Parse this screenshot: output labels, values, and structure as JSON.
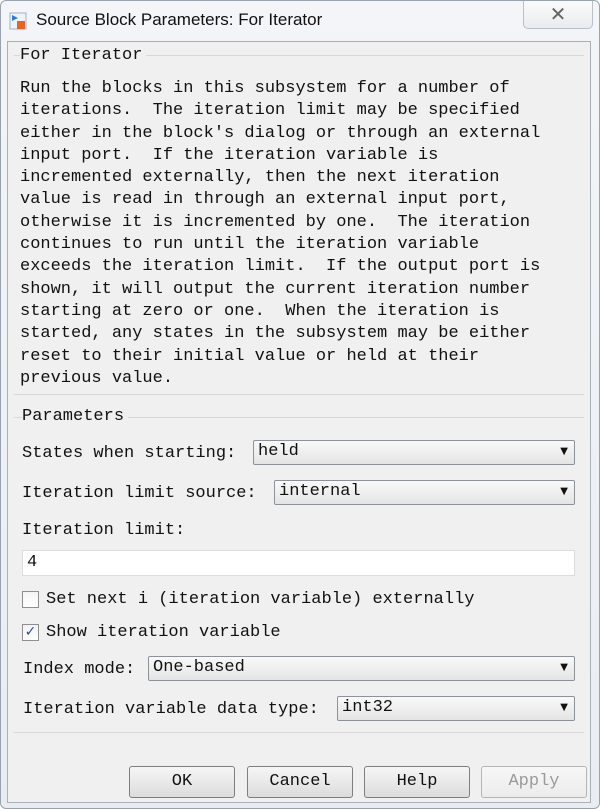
{
  "window": {
    "title": "Source Block Parameters: For Iterator",
    "close_glyph": "✕"
  },
  "description": {
    "group_label": "For Iterator",
    "lines": [
      "Run the blocks in this subsystem for a number of",
      "iterations.  The iteration limit may be specified",
      "either in the block's dialog or through an external",
      "input port.  If the iteration variable is",
      "incremented externally, then the next iteration",
      "value is read in through an external input port,",
      "otherwise it is incremented by one.  The iteration",
      "continues to run until the iteration variable",
      "exceeds the iteration limit.  If the output port is",
      "shown, it will output the current iteration number",
      "starting at zero or one.  When the iteration is",
      "started, any states in the subsystem may be either",
      "reset to their initial value or held at their",
      "previous value."
    ]
  },
  "parameters": {
    "group_label": "Parameters",
    "states_label": "States when starting:",
    "states_value": "held",
    "limit_source_label": "Iteration limit source:",
    "limit_source_value": "internal",
    "limit_label": "Iteration limit:",
    "limit_value": "4",
    "set_next_label": "Set next i (iteration variable) externally",
    "set_next_checked": false,
    "show_var_label": "Show iteration variable",
    "show_var_checked": true,
    "index_mode_label": "Index mode:",
    "index_mode_value": "One-based",
    "data_type_label": "Iteration variable data type:",
    "data_type_value": "int32",
    "check_glyph": "✓",
    "arrow_glyph": "▼"
  },
  "buttons": {
    "ok": "OK",
    "cancel": "Cancel",
    "help": "Help",
    "apply": "Apply"
  }
}
